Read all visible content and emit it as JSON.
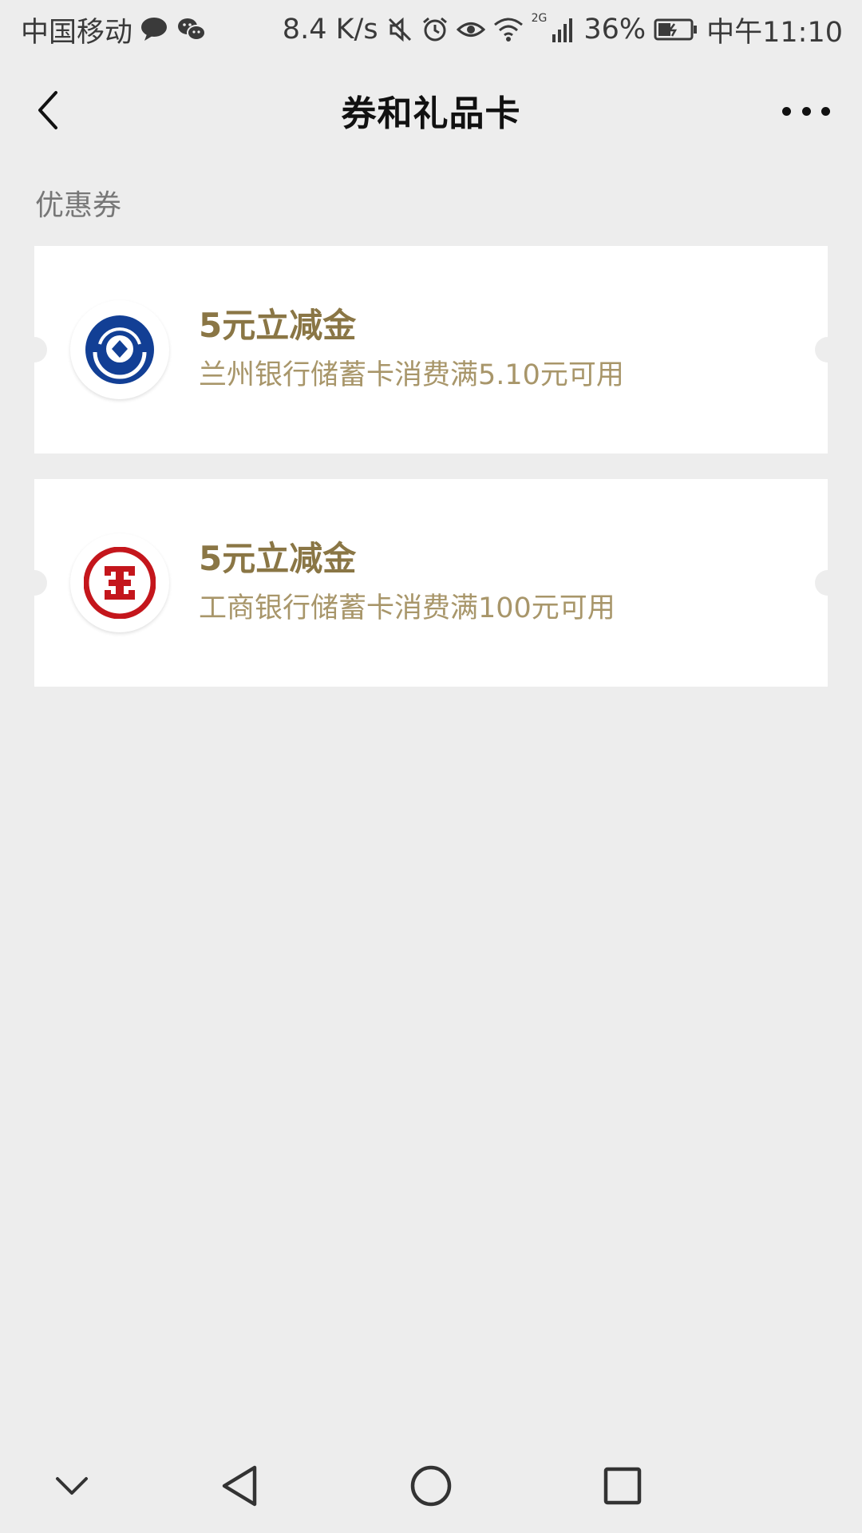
{
  "status_bar": {
    "carrier": "中国移动",
    "speed": "8.4 K/s",
    "network": "2G",
    "battery": "36%",
    "time": "中午11:10",
    "left_icons": [
      "chat-bubble-icon",
      "wechat-icon"
    ],
    "right_icons": [
      "mute-icon",
      "alarm-icon",
      "eye-icon",
      "wifi-icon",
      "signal-icon",
      "battery-charging-icon"
    ]
  },
  "nav": {
    "title": "券和礼品卡",
    "back_icon": "back-arrow-icon",
    "more_icon": "more-icon"
  },
  "section": {
    "label": "优惠券"
  },
  "coupons": [
    {
      "title": "5元立减金",
      "description": "兰州银行储蓄卡消费满5.10元可用",
      "logo": "bank-of-lanzhou-logo",
      "logo_color": "#123f95"
    },
    {
      "title": "5元立减金",
      "description": "工商银行储蓄卡消费满100元可用",
      "logo": "icbc-logo",
      "logo_color": "#c4161c"
    }
  ],
  "system_nav": {
    "icons": [
      "chevron-down-icon",
      "back-triangle-icon",
      "home-circle-icon",
      "recents-square-icon"
    ]
  },
  "colors": {
    "background": "#ededed",
    "coupon_title": "#8a7645",
    "coupon_desc": "#a8966a"
  }
}
